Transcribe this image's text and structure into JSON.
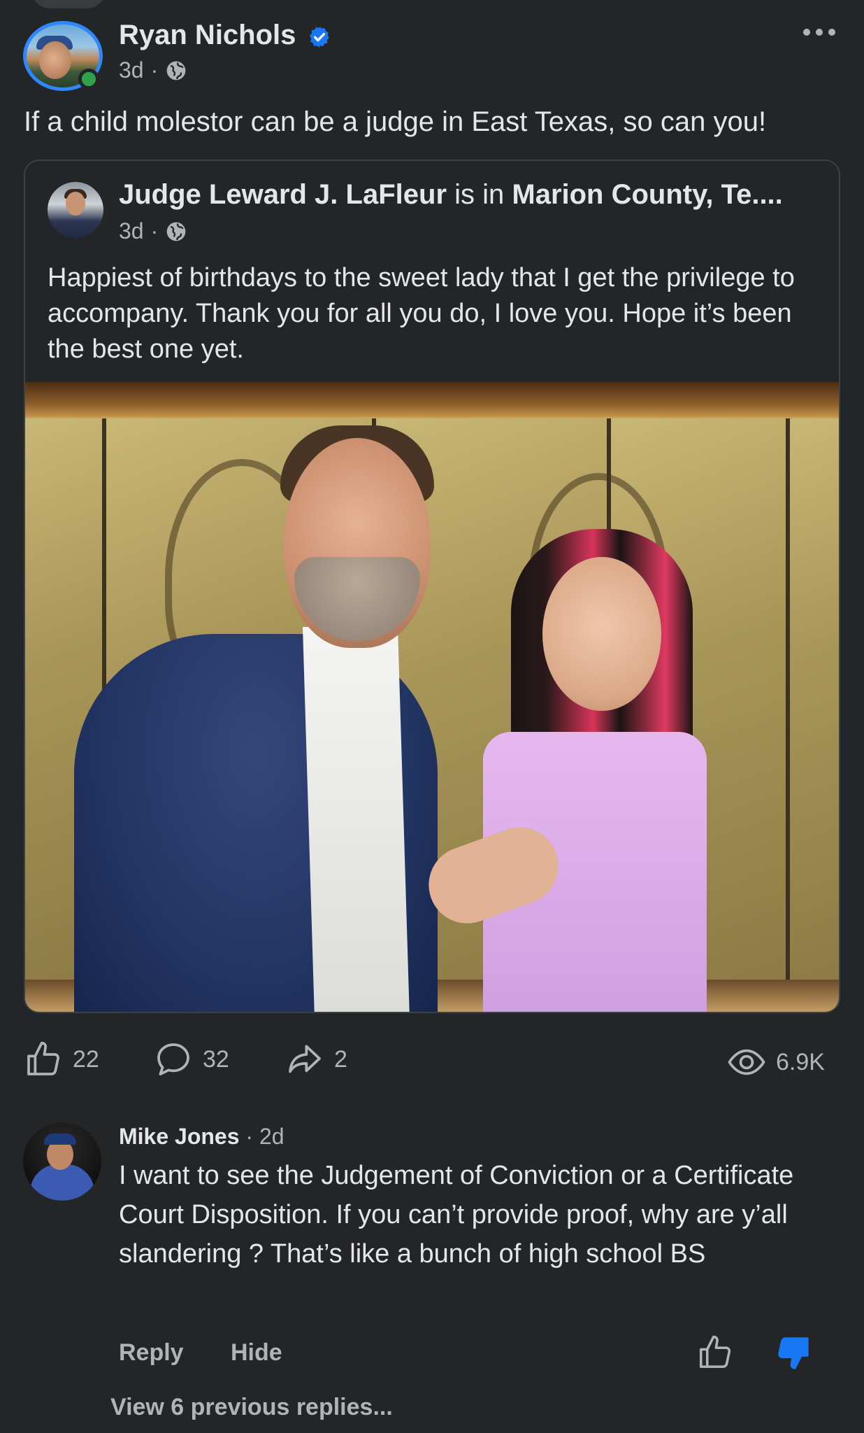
{
  "post": {
    "author": "Ryan Nichols",
    "time": "3d",
    "separator": "·",
    "text": "If a child molestor can be a judge in East Texas, so can you!",
    "icons": {
      "verified": "verified-badge-icon",
      "audience": "globe-icon",
      "more": "more-options-icon"
    }
  },
  "shared": {
    "author": "Judge Leward J. LaFleur",
    "connector": " is in ",
    "location": "Marion County, Te....",
    "time": "3d",
    "separator": "·",
    "text": "Happiest of birthdays to the sweet lady that I get the privilege to accompany. Thank you for all you do, I love you. Hope it’s been the best one yet."
  },
  "actions": {
    "likes": "22",
    "comments": "32",
    "shares": "2",
    "views": "6.9K"
  },
  "comment": {
    "author": "Mike Jones",
    "time": "· 2d",
    "text": "I want to see the Judgement of Conviction or a Certificate Court Disposition. If you can’t provide proof, why are y’all slandering ? That’s like a bunch of high school BS",
    "reply_label": "Reply",
    "hide_label": "Hide",
    "view_replies": "View 6 previous replies..."
  },
  "colors": {
    "background": "#242526",
    "text_primary": "#e4e6eb",
    "text_secondary": "#b0b3b8",
    "accent_blue": "#1877f2",
    "online_green": "#31a24c"
  }
}
